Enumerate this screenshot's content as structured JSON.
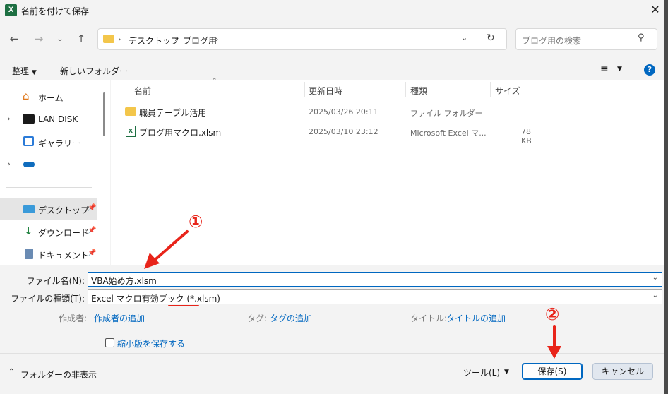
{
  "window": {
    "title": "名前を付けて保存",
    "app_icon": "excel-icon"
  },
  "address_bar": {
    "crumbs": [
      "デスクトップ",
      "ブログ用"
    ]
  },
  "search": {
    "placeholder": "ブログ用の検索"
  },
  "toolbar": {
    "organize": "整理",
    "new_folder": "新しいフォルダー"
  },
  "nav_pane": {
    "items": [
      {
        "label": "ホーム",
        "icon": "home-icon"
      },
      {
        "label": "LAN DISK",
        "icon": "nas-icon"
      },
      {
        "label": "ギャラリー",
        "icon": "gallery-icon"
      },
      {
        "label": "",
        "icon": "onedrive-icon"
      },
      {
        "label": "デスクトップ",
        "icon": "desktop-icon",
        "selected": true,
        "pinned": true
      },
      {
        "label": "ダウンロード",
        "icon": "download-icon",
        "pinned": true
      },
      {
        "label": "ドキュメント",
        "icon": "document-icon",
        "pinned": true
      }
    ]
  },
  "file_list": {
    "columns": [
      "名前",
      "更新日時",
      "種類",
      "サイズ"
    ],
    "rows": [
      {
        "name": "職員テーブル活用",
        "modified": "2025/03/26 20:11",
        "type": "ファイル フォルダー",
        "size": "",
        "icon": "folder-icon"
      },
      {
        "name": "ブログ用マクロ.xlsm",
        "modified": "2025/03/10 23:12",
        "type": "Microsoft Excel マ...",
        "size": "78 KB",
        "icon": "excel-file-icon"
      }
    ]
  },
  "form": {
    "filename_label": "ファイル名(N):",
    "filename_value": "VBA始め方.xlsm",
    "filetype_label": "ファイルの種類(T):",
    "filetype_value": "Excel マクロ有効ブック (*.xlsm)",
    "author_label": "作成者:",
    "author_link": "作成者の追加",
    "tag_label": "タグ:",
    "tag_link": "タグの追加",
    "title_label": "タイトル:",
    "title_link": "タイトルの追加",
    "thumbnail_label": "縮小版を保存する",
    "thumbnail_checked": false
  },
  "footer": {
    "hide_folders": "フォルダーの非表示",
    "tools": "ツール(L)",
    "save": "保存(S)",
    "cancel": "キャンセル"
  },
  "annotations": {
    "marker1": "①",
    "marker2": "②",
    "color": "#e8241a"
  }
}
